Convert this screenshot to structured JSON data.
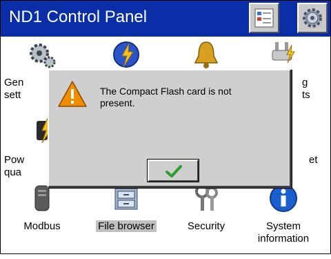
{
  "window": {
    "title": "ND1 Control Panel",
    "title_bar_color": "#0a2ea8"
  },
  "toolbar": [
    {
      "name": "view-toggle",
      "icon": "list-view-icon"
    },
    {
      "name": "settings",
      "icon": "gear-icon"
    }
  ],
  "tiles": [
    {
      "label": "Gen",
      "label2": "sett",
      "icon": "gears-icon"
    },
    {
      "label": "",
      "icon": "energy-globe-icon"
    },
    {
      "label": "",
      "icon": "bell-icon"
    },
    {
      "label": "g",
      "label2": "ts",
      "icon": "plug-icon"
    },
    {
      "label": "Pow",
      "label2": "qua",
      "icon": "power-quality-icon"
    },
    {
      "label": "et",
      "icon": "network-icon"
    },
    {
      "label": "Modbus",
      "icon": "modbus-icon"
    },
    {
      "label": "File browser",
      "icon": "file-cabinet-icon",
      "selected": true
    },
    {
      "label": "Security",
      "icon": "keys-icon"
    },
    {
      "label": "System",
      "label2": "information",
      "icon": "info-icon"
    }
  ],
  "dialog": {
    "icon": "warning-icon",
    "message_line1": "The Compact Flash card is not",
    "message_line2": "present.",
    "ok_icon": "checkmark-icon",
    "accent": "#f08c00",
    "ok_color": "#2aa02a"
  }
}
